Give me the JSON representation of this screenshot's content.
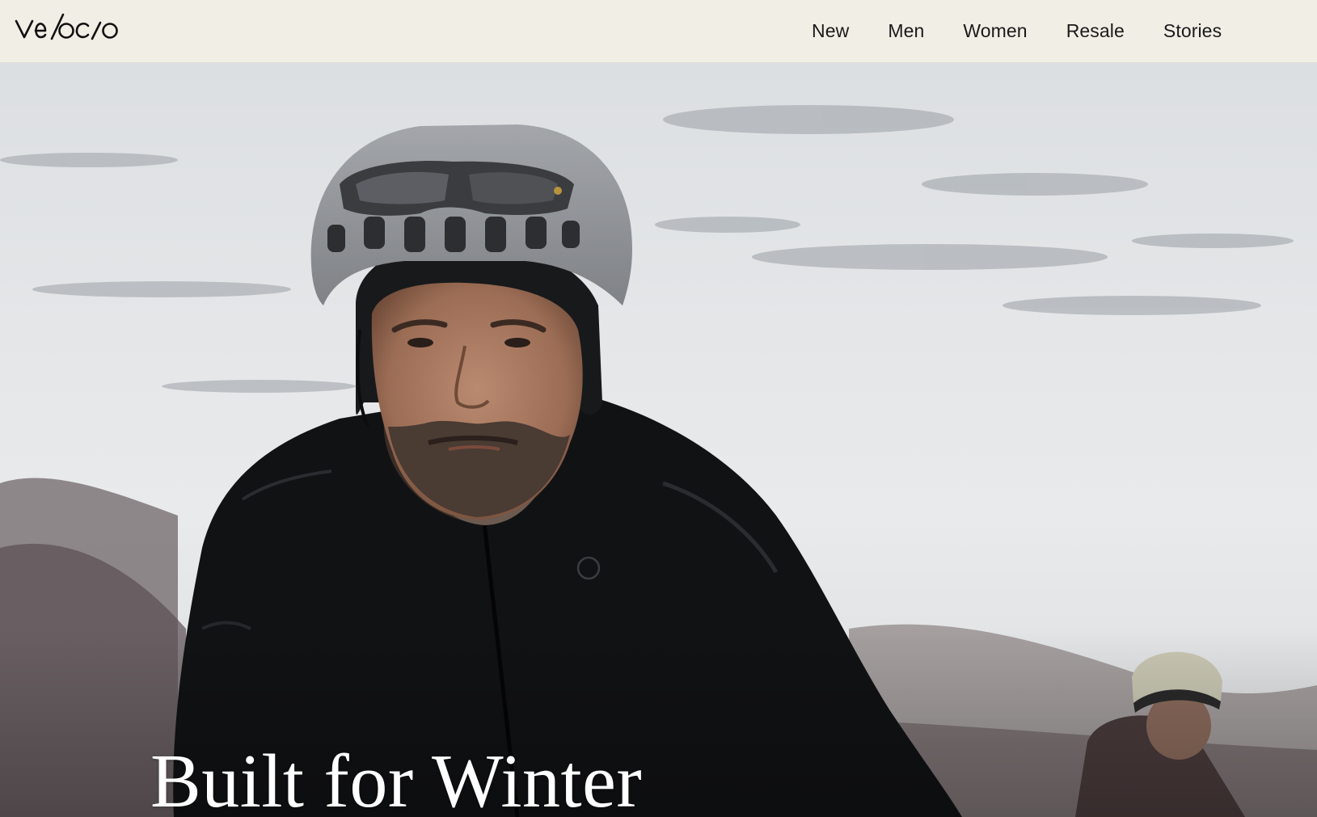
{
  "brand": {
    "logo_text": "velocio"
  },
  "nav": {
    "items": [
      {
        "label": "New"
      },
      {
        "label": "Men"
      },
      {
        "label": "Women"
      },
      {
        "label": "Resale"
      },
      {
        "label": "Stories"
      }
    ]
  },
  "hero": {
    "title": "Built for Winter",
    "image_subject": "cyclist-in-winter-jacket"
  },
  "colors": {
    "header_bg": "#f1eee6",
    "nav_text": "#1a1a1a",
    "hero_title": "#ffffff",
    "jacket": "#111214"
  }
}
